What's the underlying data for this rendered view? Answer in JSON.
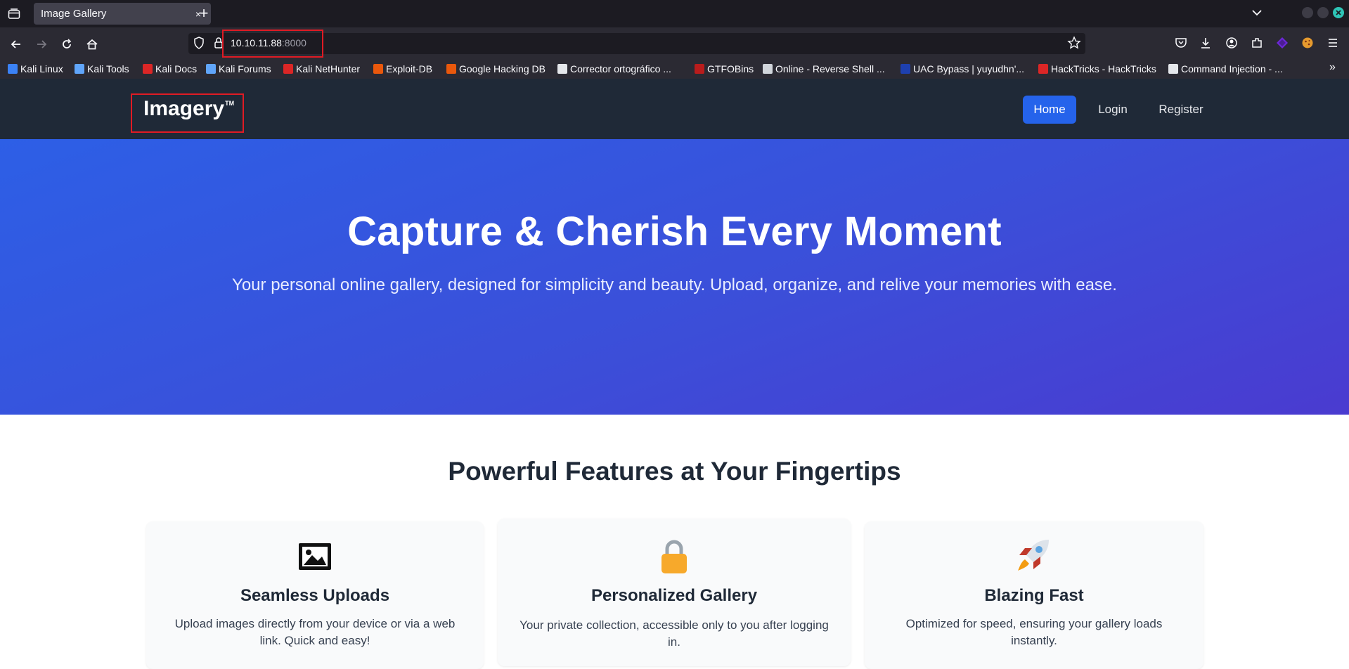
{
  "browser": {
    "tab_title": "Image Gallery",
    "tab_close": "×",
    "new_tab": "+",
    "url_host": "10.10.11.88",
    "url_port": ":8000",
    "bookmarks": [
      {
        "label": "Kali Linux",
        "color": "#3b82f6"
      },
      {
        "label": "Kali Tools",
        "color": "#60a5fa"
      },
      {
        "label": "Kali Docs",
        "color": "#dc2626"
      },
      {
        "label": "Kali Forums",
        "color": "#60a5fa"
      },
      {
        "label": "Kali NetHunter",
        "color": "#dc2626"
      },
      {
        "label": "Exploit-DB",
        "color": "#ea580c"
      },
      {
        "label": "Google Hacking DB",
        "color": "#ea580c"
      },
      {
        "label": "Corrector ortográfico ...",
        "color": "#e5e7eb"
      },
      {
        "label": "GTFOBins",
        "color": "#b91c1c"
      },
      {
        "label": "Online - Reverse Shell ...",
        "color": "#d1d5db"
      },
      {
        "label": "UAC Bypass | yuyudhn'...",
        "color": "#1e40af"
      },
      {
        "label": "HackTricks - HackTricks",
        "color": "#dc2626"
      },
      {
        "label": "Command Injection - ...",
        "color": "#e5e7eb"
      }
    ],
    "bookmarks_more": "»"
  },
  "site": {
    "logo": "Imagery",
    "logo_tm": "TM",
    "nav": {
      "home": "Home",
      "login": "Login",
      "register": "Register"
    },
    "accent_color": "#2563eb"
  },
  "hero": {
    "title": "Capture & Cherish Every Moment",
    "subtitle": "Your personal online gallery, designed for simplicity and beauty. Upload, organize, and relive your memories with ease."
  },
  "features": {
    "heading": "Powerful Features at Your Fingertips",
    "cards": [
      {
        "icon": "framed-picture-icon",
        "title": "Seamless Uploads",
        "text": "Upload images directly from your device or via a web link. Quick and easy!"
      },
      {
        "icon": "lock-icon",
        "title": "Personalized Gallery",
        "text": "Your private collection, accessible only to you after logging in."
      },
      {
        "icon": "rocket-icon",
        "title": "Blazing Fast",
        "text": "Optimized for speed, ensuring your gallery loads instantly."
      }
    ]
  }
}
